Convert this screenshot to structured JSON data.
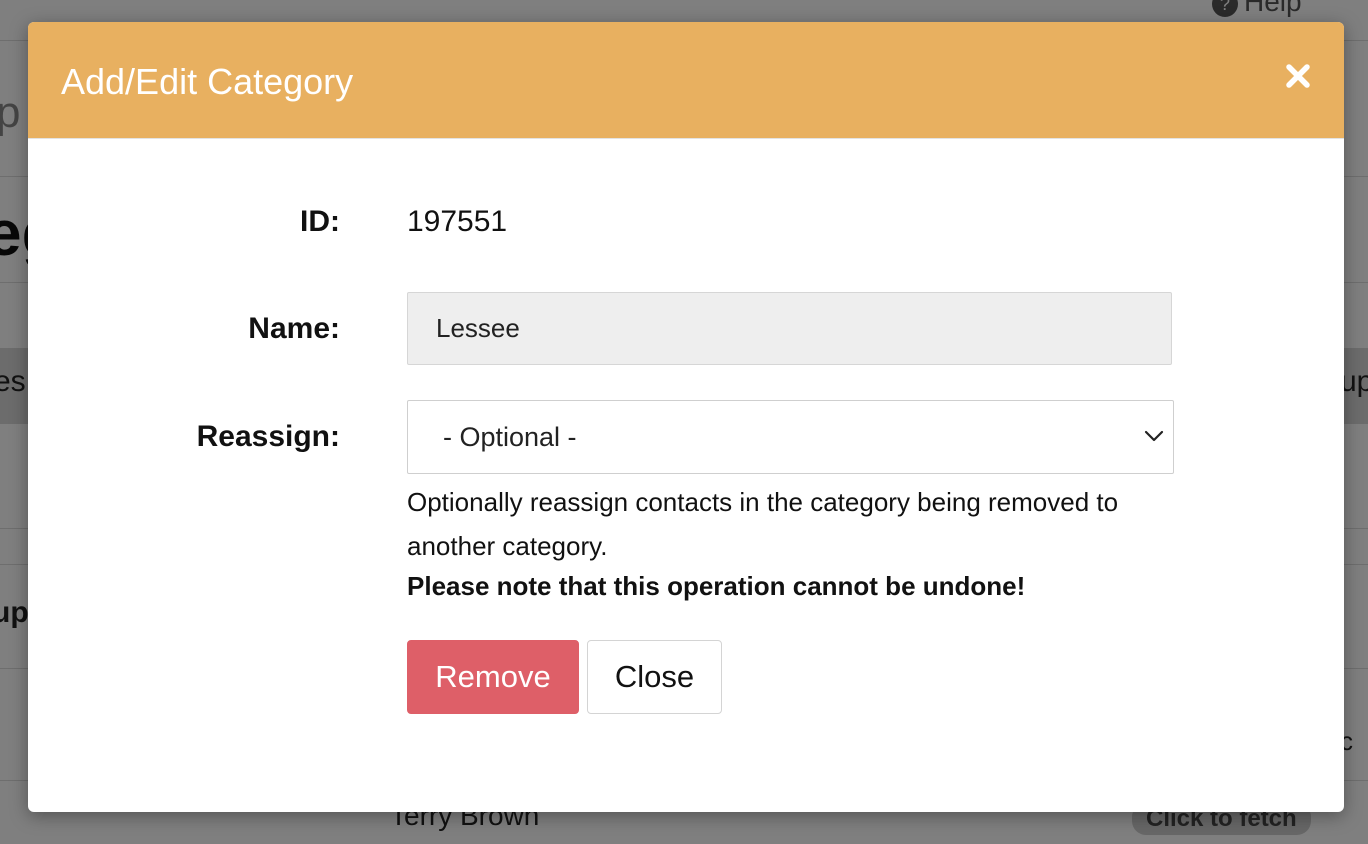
{
  "background": {
    "help_label": "Help",
    "help_icon": "question-circle-icon",
    "left_fragment_1": "p",
    "left_fragment_2": "eg",
    "left_fragment_3": "es",
    "right_fragment_1": "up",
    "left_fragment_4": "up",
    "right_fragment_2": "c",
    "row_name": "Terry Brown",
    "fetch_label": "Click to fetch"
  },
  "modal": {
    "title": "Add/Edit Category",
    "close_icon": "close-icon",
    "header_color": "#e8b060",
    "fields": {
      "id_label": "ID:",
      "id_value": "197551",
      "name_label": "Name:",
      "name_value": "Lessee",
      "reassign_label": "Reassign:",
      "reassign_selected": "- Optional -"
    },
    "help_text": "Optionally reassign contacts in the category being removed to another category.",
    "warning_text": "Please note that this operation cannot be undone!",
    "buttons": {
      "remove_label": "Remove",
      "remove_color": "#de5f68",
      "close_label": "Close"
    }
  }
}
